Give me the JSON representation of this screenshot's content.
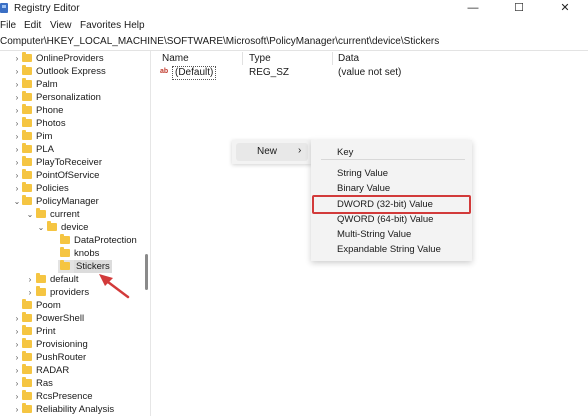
{
  "window": {
    "title": "Registry Editor",
    "minimize": "—",
    "maximize": "☐",
    "close": "✕"
  },
  "menu": [
    "File",
    "Edit",
    "View",
    "Favorites",
    "Help"
  ],
  "address": "Computer\\HKEY_LOCAL_MACHINE\\SOFTWARE\\Microsoft\\PolicyManager\\current\\device\\Stickers",
  "tree": [
    {
      "label": "OnlineProviders",
      "level": 1,
      "expander": "collapsed"
    },
    {
      "label": "Outlook Express",
      "level": 1,
      "expander": "collapsed"
    },
    {
      "label": "Palm",
      "level": 1,
      "expander": "collapsed"
    },
    {
      "label": "Personalization",
      "level": 1,
      "expander": "collapsed"
    },
    {
      "label": "Phone",
      "level": 1,
      "expander": "collapsed"
    },
    {
      "label": "Photos",
      "level": 1,
      "expander": "collapsed"
    },
    {
      "label": "Pim",
      "level": 1,
      "expander": "collapsed"
    },
    {
      "label": "PLA",
      "level": 1,
      "expander": "collapsed"
    },
    {
      "label": "PlayToReceiver",
      "level": 1,
      "expander": "collapsed"
    },
    {
      "label": "PointOfService",
      "level": 1,
      "expander": "collapsed"
    },
    {
      "label": "Policies",
      "level": 1,
      "expander": "collapsed"
    },
    {
      "label": "PolicyManager",
      "level": 1,
      "expander": "expanded"
    },
    {
      "label": "current",
      "level": 2,
      "expander": "expanded"
    },
    {
      "label": "device",
      "level": 3,
      "expander": "expanded"
    },
    {
      "label": "DataProtection",
      "level": 4,
      "expander": "none"
    },
    {
      "label": "knobs",
      "level": 4,
      "expander": "none"
    },
    {
      "label": "Stickers",
      "level": 4,
      "expander": "none",
      "selected": true
    },
    {
      "label": "default",
      "level": 2,
      "expander": "collapsed"
    },
    {
      "label": "providers",
      "level": 2,
      "expander": "collapsed"
    },
    {
      "label": "Poom",
      "level": 1,
      "expander": "none"
    },
    {
      "label": "PowerShell",
      "level": 1,
      "expander": "collapsed"
    },
    {
      "label": "Print",
      "level": 1,
      "expander": "collapsed"
    },
    {
      "label": "Provisioning",
      "level": 1,
      "expander": "collapsed"
    },
    {
      "label": "PushRouter",
      "level": 1,
      "expander": "collapsed"
    },
    {
      "label": "RADAR",
      "level": 1,
      "expander": "collapsed"
    },
    {
      "label": "Ras",
      "level": 1,
      "expander": "collapsed"
    },
    {
      "label": "RcsPresence",
      "level": 1,
      "expander": "collapsed"
    },
    {
      "label": "Reliability Analysis",
      "level": 1,
      "expander": "collapsed"
    }
  ],
  "columns": {
    "name": "Name",
    "type": "Type",
    "data": "Data"
  },
  "values": [
    {
      "icon": "ab",
      "name": "(Default)",
      "type": "REG_SZ",
      "data": "(value not set)"
    }
  ],
  "context_menu": {
    "label": "New",
    "arrow": "›"
  },
  "submenu": [
    "Key",
    "String Value",
    "Binary Value",
    "DWORD (32-bit) Value",
    "QWORD (64-bit) Value",
    "Multi-String Value",
    "Expandable String Value"
  ],
  "highlight_item": "DWORD (32-bit) Value",
  "colors": {
    "folder": "#f5c542",
    "annotation": "#d23a3a"
  }
}
